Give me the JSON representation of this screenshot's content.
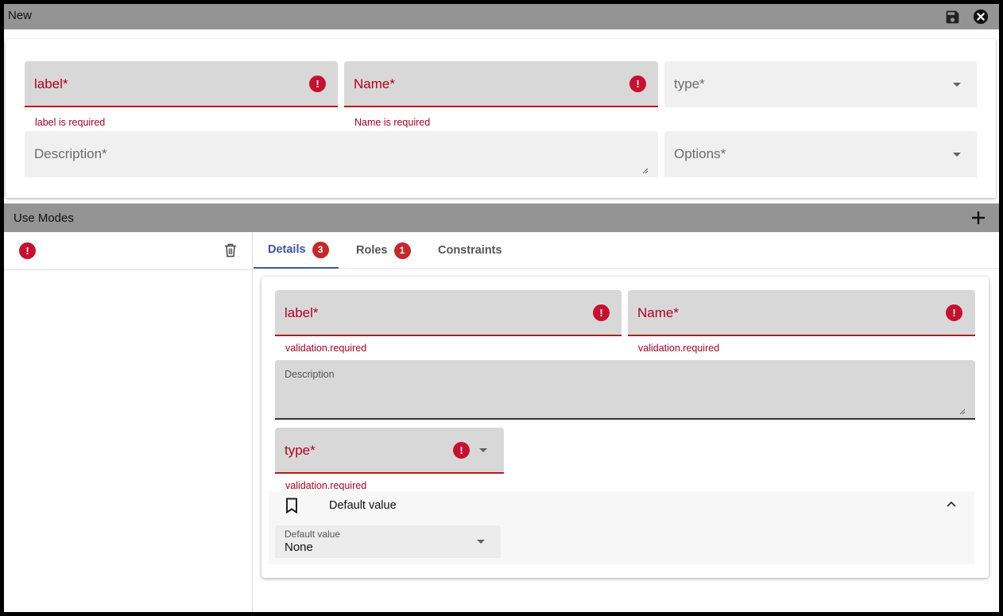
{
  "window": {
    "title": "New",
    "save_icon": "save-icon",
    "close_icon": "close-icon"
  },
  "top_form": {
    "label_field": {
      "label": "label*",
      "helper": "label is required"
    },
    "name_field": {
      "label": "Name*",
      "helper": "Name is required"
    },
    "type_field": {
      "label": "type*"
    },
    "description_field": {
      "label": "Description*"
    },
    "options_field": {
      "label": "Options*"
    }
  },
  "use_modes": {
    "title": "Use Modes",
    "add_icon": "plus-icon",
    "items": [
      {
        "error_icon": "error-icon",
        "delete_icon": "trash-icon"
      }
    ]
  },
  "tabs": [
    {
      "label": "Details",
      "badge": "3",
      "active": true
    },
    {
      "label": "Roles",
      "badge": "1",
      "active": false
    },
    {
      "label": "Constraints",
      "badge": "",
      "active": false
    }
  ],
  "details": {
    "label_field": {
      "label": "label*",
      "helper": "validation.required"
    },
    "name_field": {
      "label": "Name*",
      "helper": "validation.required"
    },
    "description_field": {
      "label": "Description"
    },
    "type_field": {
      "label": "type*",
      "helper": "validation.required"
    },
    "default_value_panel": {
      "title": "Default value",
      "icon": "bookmark-icon",
      "expanded": true,
      "select": {
        "label": "Default value",
        "value": "None"
      }
    }
  },
  "colors": {
    "error": "#b00020",
    "accent": "#3f51b5",
    "titlebar": "#949494"
  }
}
